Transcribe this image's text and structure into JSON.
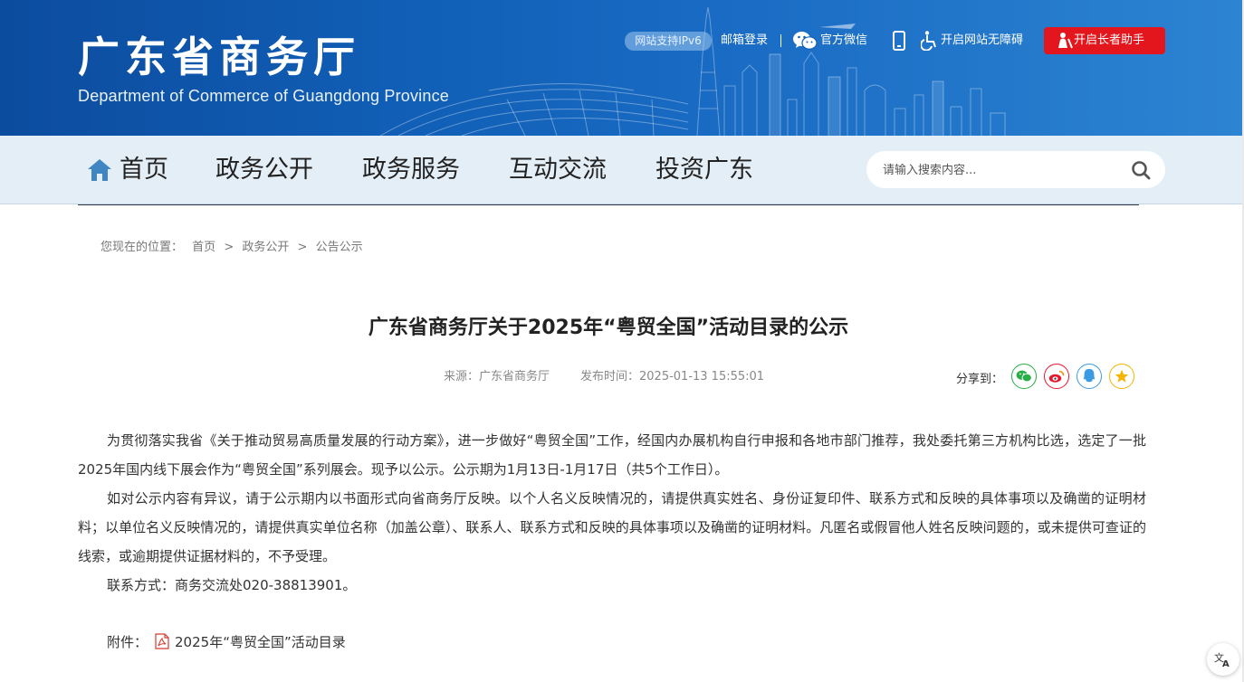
{
  "header": {
    "title": "广东省商务厅",
    "subtitle": "Department of Commerce of Guangdong Province",
    "ipv6_badge": "网站支持IPv6",
    "mail_login": "邮箱登录",
    "wechat": "官方微信",
    "accessibility": "开启网站无障碍",
    "elder_mode": "开启长者助手"
  },
  "nav": {
    "items": [
      "首页",
      "政务公开",
      "政务服务",
      "互动交流",
      "投资广东"
    ],
    "search_placeholder": "请输入搜索内容..."
  },
  "breadcrumb": {
    "label": "您现在的位置：",
    "items": [
      "首页",
      "政务公开",
      "公告公示"
    ],
    "separator": ">"
  },
  "article": {
    "title": "广东省商务厅关于2025年“粤贸全国”活动目录的公示",
    "source": "来源：广东省商务厅",
    "publish_time": "发布时间：2025-01-13 15:55:01",
    "share_label": "分享到：",
    "paragraphs": [
      "为贯彻落实我省《关于推动贸易高质量发展的行动方案》，进一步做好“粤贸全国”工作，经国内办展机构自行申报和各地市部门推荐，我处委托第三方机构比选，选定了一批2025年国内线下展会作为“粤贸全国”系列展会。现予以公示。公示期为1月13日-1月17日（共5个工作日）。",
      "如对公示内容有异议，请于公示期内以书面形式向省商务厅反映。以个人名义反映情况的，请提供真实姓名、身份证复印件、联系方式和反映的具体事项以及确凿的证明材料；以单位名义反映情况的，请提供真实单位名称（加盖公章）、联系人、联系方式和反映的具体事项以及确凿的证明材料。凡匿名或假冒他人姓名反映问题的，或未提供可查证的线索，或逾期提供证据材料的，不予受理。",
      "联系方式：商务交流处020-38813901。"
    ],
    "attachment_label": "附件：",
    "attachment_name": "2025年“粤贸全国”活动目录"
  },
  "icons": {
    "home": "home-icon",
    "search": "search-icon",
    "wechat": "wechat-icon",
    "mobile": "mobile-icon",
    "accessibility": "wheelchair-icon",
    "elder": "elder-assistant-icon",
    "share": [
      "wechat-share-icon",
      "weibo-share-icon",
      "qq-share-icon",
      "qzone-share-icon"
    ],
    "pdf": "pdf-file-icon",
    "translate": "translate-icon"
  },
  "colors": {
    "banner": "#1160b8",
    "nav_bg": "#e4eef6",
    "elder_button": "#e3161d",
    "wechat_green": "#2aae48",
    "weibo_red": "#e6162d",
    "qq_blue": "#3a9be3",
    "qzone_yellow": "#f4b400"
  }
}
